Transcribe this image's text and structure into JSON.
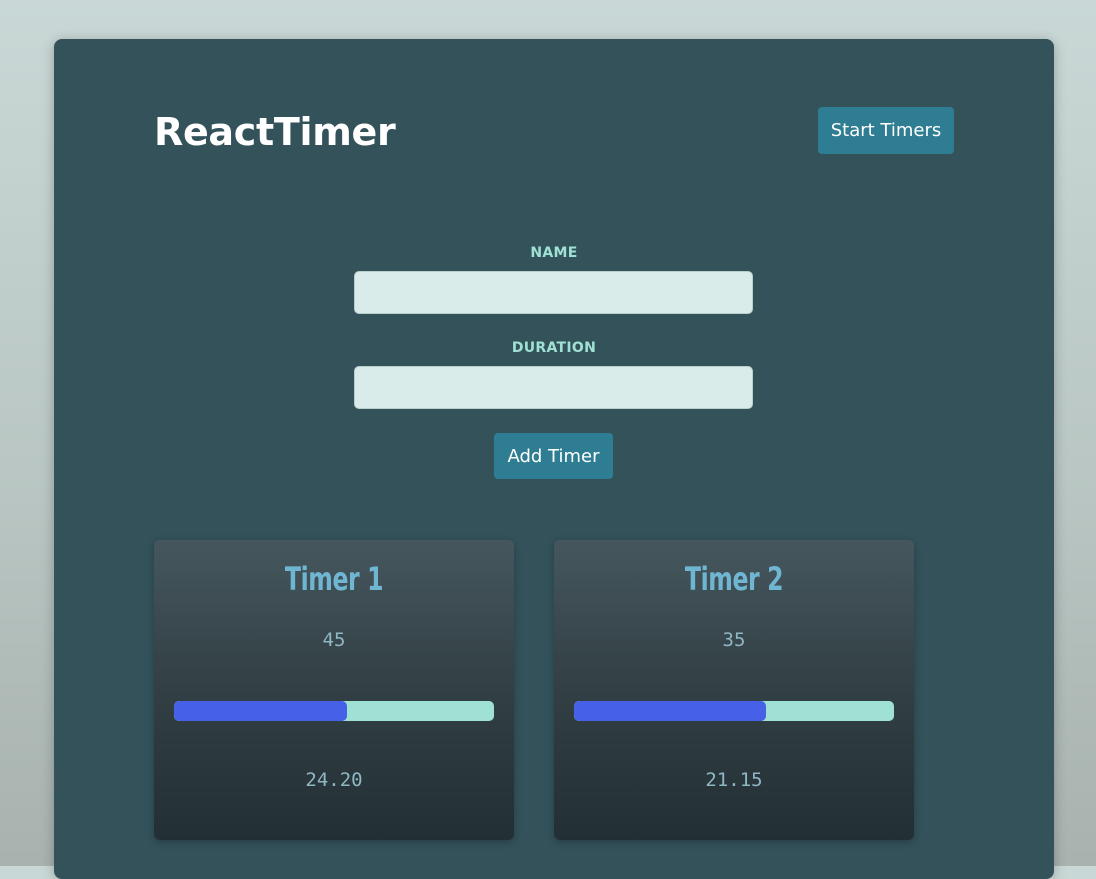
{
  "header": {
    "title": "ReactTimer",
    "start_label": "Start Timers"
  },
  "form": {
    "name_label": "NAME",
    "name_value": "",
    "duration_label": "DURATION",
    "duration_value": "",
    "add_label": "Add Timer"
  },
  "timers": [
    {
      "name": "Timer 1",
      "duration": "45",
      "progress_percent": 54,
      "remaining": "24.20"
    },
    {
      "name": "Timer 2",
      "duration": "35",
      "progress_percent": 60,
      "remaining": "21.15"
    }
  ],
  "colors": {
    "panel": "#33525a",
    "accent_button": "#2f7d93",
    "label": "#9fe2d4",
    "progress_track": "#9fe2d4",
    "progress_fill": "#4760e8",
    "timer_title": "#6fb6d3"
  }
}
